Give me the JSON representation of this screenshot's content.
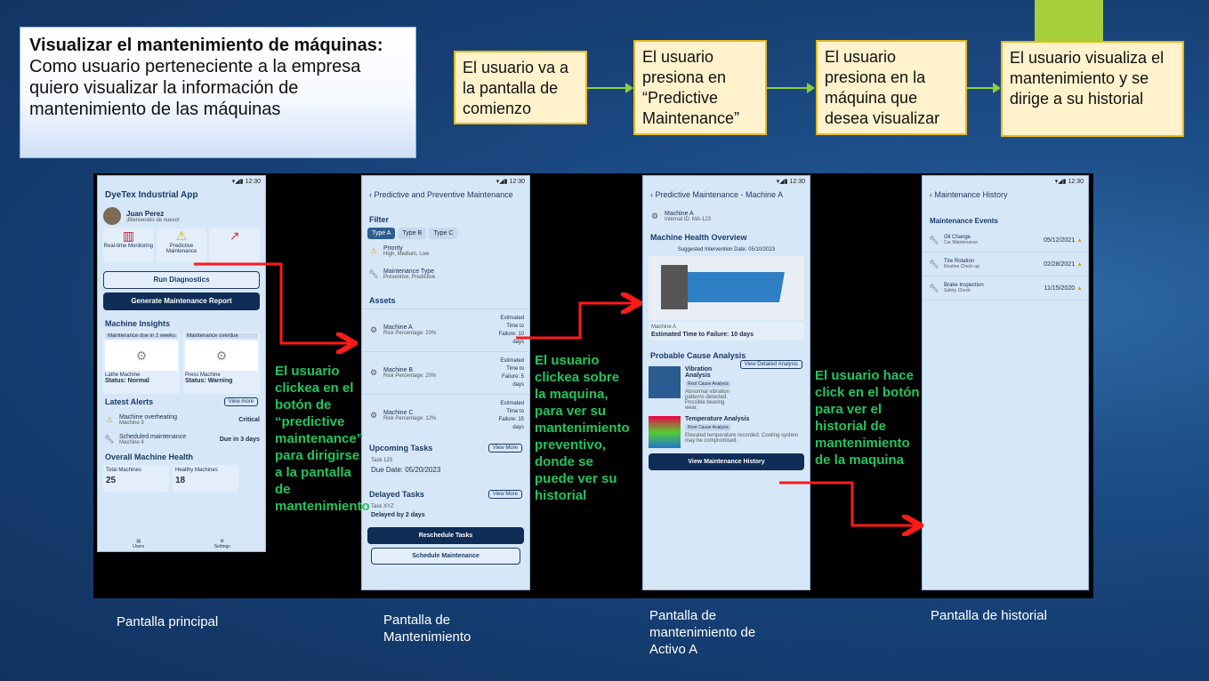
{
  "story": {
    "title": "Visualizar el mantenimiento de máquinas:",
    "body": "Como usuario perteneciente a la empresa quiero visualizar la información de mantenimiento de las máquinas"
  },
  "flow": [
    "El usuario va a la pantalla de comienzo",
    "El usuario presiona en “Predictive Maintenance”",
    "El usuario presiona en la máquina que desea visualizar",
    "El usuario visualiza el mantenimiento y se dirige a su historial"
  ],
  "status_time": "12:30",
  "screen1": {
    "app_title": "DyeTex Industrial App",
    "user_name": "Juan Perez",
    "user_greeting": "¡Bienvenido de nuevo!",
    "tiles": [
      "Real-time Monitoring",
      "Predictive Maintenance",
      ""
    ],
    "run_diagnostics": "Run Diagnostics",
    "generate_report": "Generate Maintenance Report",
    "insights_title": "Machine Insights",
    "insight_cards": [
      {
        "tag": "Maintenance due in 2 weeks",
        "name": "Lathe Machine",
        "status": "Status: Normal"
      },
      {
        "tag": "Maintenance overdue",
        "name": "Press Machine",
        "status": "Status: Warning"
      }
    ],
    "alerts_title": "Latest Alerts",
    "view_more": "View more",
    "alerts": [
      {
        "title": "Machine overheating",
        "sub": "Machine 3",
        "right": "Critical"
      },
      {
        "title": "Scheduled maintenance",
        "sub": "Machine 4",
        "right": "Due in 3 days"
      }
    ],
    "health_title": "Overall Machine Health",
    "health": [
      {
        "label": "Total Machines",
        "value": "25"
      },
      {
        "label": "Healthy Machines",
        "value": "18"
      }
    ],
    "nav": [
      "Users",
      "Settings"
    ]
  },
  "screen2": {
    "title": "Predictive and Preventive Maintenance",
    "filter_title": "Filter",
    "filters": [
      "Type A",
      "Type B",
      "Type C"
    ],
    "priority_label": "Priority",
    "priority_values": "High, Medium, Low",
    "mtype_label": "Maintenance Type",
    "mtype_values": "Preventive, Predictive",
    "assets_title": "Assets",
    "assets": [
      {
        "name": "Machine A",
        "risk": "Risk Percentage: 20%",
        "ttf": "Estimated Time to Failure: 10 days"
      },
      {
        "name": "Machine B",
        "risk": "Risk Percentage: 20%",
        "ttf": "Estimated Time to Failure: 5 days"
      },
      {
        "name": "Machine C",
        "risk": "Risk Percentage: 12%",
        "ttf": "Estimated Time to Failure: 15 days"
      }
    ],
    "upcoming_title": "Upcoming Tasks",
    "view_more": "View More",
    "upcoming_task": "Task 123",
    "upcoming_due": "Due Date: 05/20/2023",
    "delayed_title": "Delayed Tasks",
    "delayed_task": "Task XYZ",
    "delayed_by": "Delayed by 2 days",
    "reschedule": "Reschedule Tasks",
    "schedule": "Schedule Maintenance"
  },
  "screen3": {
    "title": "Predictive Maintenance - Machine A",
    "machine": "Machine A",
    "internal_id": "Internal ID: MA-123",
    "health_title": "Machine Health Overview",
    "suggested": "Suggested Intervention Date: 05/10/2023",
    "img_caption": "Machine A",
    "ttf": "Estimated Time to Failure: 10 days",
    "cause_title": "Probable Cause Analysis",
    "view_detailed": "View Detailed Analysis",
    "causes": [
      {
        "title": "Vibration Analysis",
        "tag": "Root Cause Analysis",
        "desc": "Abnormal vibration patterns detected. Possible bearing wear."
      },
      {
        "title": "Temperature Analysis",
        "tag": "Root Cause Analysis",
        "desc": "Elevated temperature recorded. Cooling system may be compromised."
      }
    ],
    "history_button": "View Maintenance History"
  },
  "screen4": {
    "title": "Maintenance History",
    "events_title": "Maintenance Events",
    "events": [
      {
        "title": "Oil Change",
        "sub": "Car Maintenance",
        "date": "05/12/2021"
      },
      {
        "title": "Tire Rotation",
        "sub": "Routine Check-up",
        "date": "02/28/2021"
      },
      {
        "title": "Brake Inspection",
        "sub": "Safety Check",
        "date": "11/15/2020"
      }
    ]
  },
  "annotations": {
    "a1": "El usuario clickea en el botón de “predictive maintenance” para dirigirse a la pantalla de mantenimiento",
    "a2": "El usuario clickea sobre la maquina, para ver su mantenimiento preventivo, donde se puede ver su historial",
    "a3": "El usuario hace click en el botón para ver el historial de mantenimiento de la maquina"
  },
  "captions": [
    "Pantalla principal",
    "Pantalla de Mantenimiento",
    "Pantalla de mantenimiento de Activo A",
    "Pantalla de historial"
  ],
  "colors": {
    "flow_fill": "#fff2cc",
    "flow_border": "#e8b91b",
    "arrow_red": "#ff1a1a",
    "annotation_green": "#22c55e",
    "accent_green": "#a6cf3a"
  }
}
